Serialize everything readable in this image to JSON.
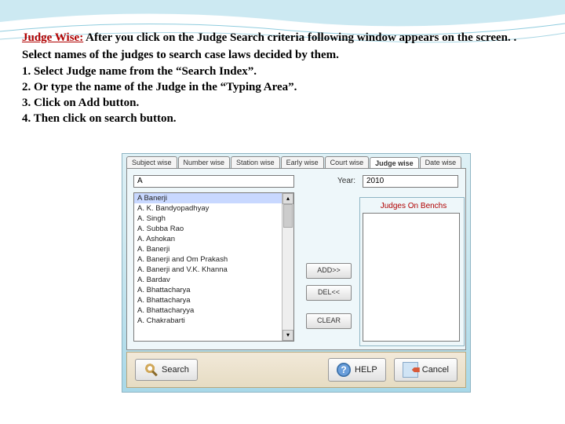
{
  "heading": "Judge Wise:",
  "intro": " After you click on the Judge Search criteria following window appears on the screen. .",
  "line2": "Select names of the judges to search case laws decided by them.",
  "step1": "1. Select Judge name from the “Search Index”.",
  "step2": "2. Or type the name of the Judge in the “Typing Area”.",
  "step3": "3. Click on Add button.",
  "step4": "4. Then click on search button.",
  "window": {
    "tabs": [
      "Subject wise",
      "Number wise",
      "Station wise",
      "Early wise",
      "Court wise",
      "Judge wise",
      "Date wise"
    ],
    "active_tab_index": 5,
    "typing_value": "A",
    "year_label": "Year:",
    "year_value": "2010",
    "judges": [
      "A Banerji",
      "A. K. Bandyopadhyay",
      "A. Singh",
      "A. Subba Rao",
      "A. Ashokan",
      "A. Banerji",
      "A. Banerji and Om Prakash",
      "A. Banerji and V.K. Khanna",
      "A. Bardav",
      "A. Bhattacharya",
      "A. Bhattacharya",
      "A. Bhattacharyya",
      "A. Chakrabarti"
    ],
    "benchs_label": "Judges On Benchs",
    "buttons": {
      "add": "ADD>>",
      "del": "DEL<<",
      "clear": "CLEAR"
    },
    "bottom": {
      "search": "Search",
      "help": "HELP",
      "cancel": "Cancel"
    }
  }
}
